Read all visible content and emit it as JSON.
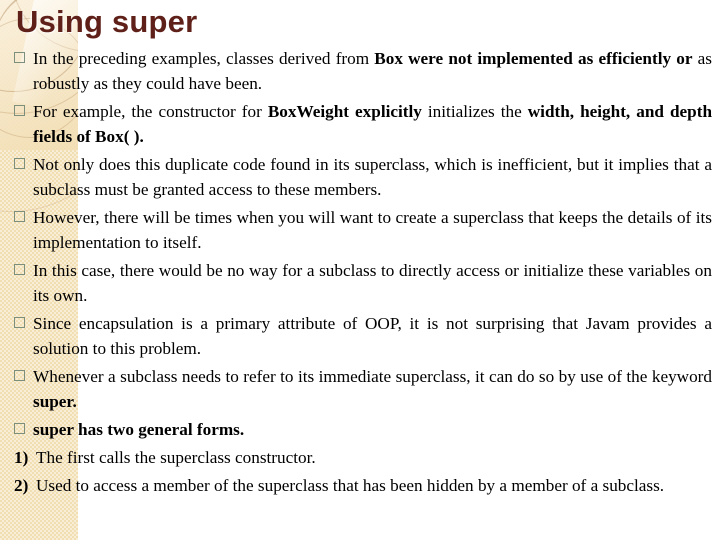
{
  "slide": {
    "title": "Using super",
    "title_color": "#5e2018",
    "band_color": "#f2deb3",
    "bullet_marker_color": "#7c8e7c",
    "body_color": "#000000",
    "background_color": "#ffffff"
  },
  "bullets": [
    {
      "marker": "hollow-square",
      "segments": [
        {
          "text": "In the preceding examples, classes derived from ",
          "bold": false
        },
        {
          "text": "Box were not implemented as efficiently or",
          "bold": true
        },
        {
          "text": " as robustly as they could have been.",
          "bold": false
        }
      ]
    },
    {
      "marker": "hollow-square",
      "segments": [
        {
          "text": "For example, the constructor for ",
          "bold": false
        },
        {
          "text": "BoxWeight explicitly",
          "bold": true
        },
        {
          "text": " initializes the ",
          "bold": false
        },
        {
          "text": "width, height, and depth fields of Box( ).",
          "bold": true
        }
      ]
    },
    {
      "marker": "hollow-square",
      "segments": [
        {
          "text": "Not only does this duplicate code found in its superclass, which is inefficient, but it implies that a subclass must be granted access to these members.",
          "bold": false
        }
      ]
    },
    {
      "marker": "hollow-square",
      "segments": [
        {
          "text": "However, there will be times when you will want to create a superclass that keeps the details of its implementation to itself.",
          "bold": false
        }
      ]
    },
    {
      "marker": "hollow-square",
      "segments": [
        {
          "text": "In this case, there would be no way for a subclass to directly access or initialize these variables on its own.",
          "bold": false
        }
      ]
    },
    {
      "marker": "hollow-square",
      "segments": [
        {
          "text": "Since encapsulation is a primary attribute of OOP, it is not surprising that Javam provides a solution to this problem.",
          "bold": false
        }
      ]
    },
    {
      "marker": "hollow-square",
      "segments": [
        {
          "text": "Whenever a subclass needs to refer to its immediate superclass, it can do so by use of the keyword ",
          "bold": false
        },
        {
          "text": "super.",
          "bold": true
        }
      ]
    },
    {
      "marker": "hollow-square",
      "segments": [
        {
          "text": "super has two general forms.",
          "bold": true
        }
      ]
    }
  ],
  "numbered": [
    {
      "marker": "1)",
      "segments": [
        {
          "text": "The first calls the superclass constructor.",
          "bold": false
        }
      ]
    },
    {
      "marker": "2)",
      "segments": [
        {
          "text": "Used to access a member of the superclass that has been hidden by a member of a subclass.",
          "bold": false
        }
      ]
    }
  ]
}
